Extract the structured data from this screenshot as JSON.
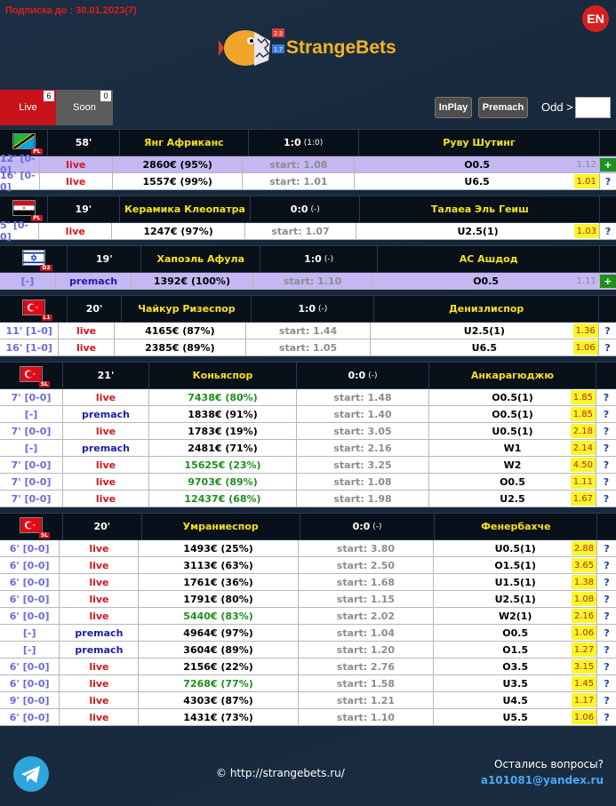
{
  "header": {
    "subscription": "Подписка до : 30.01.2023(7)",
    "lang": "EN",
    "logo_text": "StrangeBets",
    "logo_badge_top": "2.3",
    "logo_badge_bottom": "1.7"
  },
  "tabs": [
    {
      "label": "Live",
      "count": "6"
    },
    {
      "label": "Soon",
      "count": "0"
    }
  ],
  "filters": {
    "inplay": "InPlay",
    "premach": "Premach",
    "odd_label": "Odd >",
    "odd_value": ""
  },
  "matches": [
    {
      "flag": "tanzania",
      "league": "PL",
      "minute": "58'",
      "home": "Янг Африканс",
      "score": "1:0",
      "score_ht": "(1:0)",
      "away": "Руву Шутинг",
      "cols": [
        54,
        100,
        178,
        153,
        167,
        168,
        22
      ],
      "rows": [
        {
          "time": "12' [0-0]",
          "type": "live",
          "money": "2860€ (95%)",
          "start": "start: 1.08",
          "bet": "O0.5",
          "odd": "1.12",
          "act": "+",
          "hl": true
        },
        {
          "time": "16' [0-0]",
          "type": "live",
          "money": "1557€ (99%)",
          "start": "start: 1.01",
          "bet": "U6.5",
          "odd": "1.01",
          "act": "?"
        }
      ]
    },
    {
      "flag": "egypt",
      "league": "PL",
      "minute": "19'",
      "home": "Керамика Клеопатра",
      "score": "0:0",
      "score_ht": "(-)",
      "away": "Талаеа Эль Геиш",
      "cols": [
        54,
        100,
        183,
        153,
        167,
        168,
        22
      ],
      "rows": [
        {
          "time": "5' [0-0]",
          "type": "live",
          "money": "1247€ (97%)",
          "start": "start: 1.07",
          "bet": "U2.5(1)",
          "odd": "1.03",
          "act": "?"
        }
      ]
    },
    {
      "flag": "israel",
      "league": "D2",
      "minute": "19'",
      "home": "Хапоэль Афула",
      "score": "1:0",
      "score_ht": "(-)",
      "away": "АС Ашдод",
      "cols": [
        76,
        103,
        165,
        163,
        161,
        148,
        22
      ],
      "rows": [
        {
          "time": "[-]",
          "type": "premach",
          "money": "1392€ (100%)",
          "start": "start: 1.10",
          "bet": "O0.5",
          "odd": "1.11",
          "act": "+",
          "hl": true
        }
      ]
    },
    {
      "flag": "turkey",
      "league": "L1",
      "minute": "20'",
      "home": "Чайкур Ризеспор",
      "score": "1:0",
      "score_ht": "(-)",
      "away": "Денизлиспор",
      "cols": [
        76,
        71,
        170,
        160,
        168,
        126,
        22
      ],
      "rows": [
        {
          "time": "11' [1-0]",
          "type": "live",
          "money": "4165€ (87%)",
          "start": "start: 1.44",
          "bet": "U2.5(1)",
          "odd": "1.36",
          "act": "?"
        },
        {
          "time": "16' [1-0]",
          "type": "live",
          "money": "2385€ (89%)",
          "start": "start: 1.05",
          "bet": "U6.5",
          "odd": "1.06",
          "act": "?"
        }
      ]
    },
    {
      "flag": "turkey",
      "league": "SL",
      "minute": "21'",
      "home": "Коньяспор",
      "score": "0:0",
      "score_ht": "(-)",
      "away": "Анкарагюджю",
      "cols": [
        71,
        97,
        166,
        149,
        188,
        22
      ],
      "rows": [
        {
          "time": "7' [0-0]",
          "type": "live",
          "money": "7438€ (80%)",
          "start": "start: 1.48",
          "bet": "O0.5(1)",
          "odd": "1.85",
          "act": "?",
          "green": true
        },
        {
          "time": "[-]",
          "type": "premach",
          "money": "1838€ (91%)",
          "start": "start: 1.40",
          "bet": "O0.5(1)",
          "odd": "1.85",
          "act": "?"
        },
        {
          "time": "7' [0-0]",
          "type": "live",
          "money": "1783€ (19%)",
          "start": "start: 3.05",
          "bet": "U0.5(1)",
          "odd": "2.18",
          "act": "?"
        },
        {
          "time": "[-]",
          "type": "premach",
          "money": "2481€ (71%)",
          "start": "start: 2.16",
          "bet": "W1",
          "odd": "2.14",
          "act": "?"
        },
        {
          "time": "7' [0-0]",
          "type": "live",
          "money": "15625€ (23%)",
          "start": "start: 3.25",
          "bet": "W2",
          "odd": "4.50",
          "act": "?",
          "green": true
        },
        {
          "time": "7' [0-0]",
          "type": "live",
          "money": "9703€ (89%)",
          "start": "start: 1.08",
          "bet": "O0.5",
          "odd": "1.11",
          "act": "?",
          "green": true
        },
        {
          "time": "7' [0-0]",
          "type": "live",
          "money": "12437€ (68%)",
          "start": "start: 1.98",
          "bet": "U2.5",
          "odd": "1.67",
          "act": "?",
          "green": true
        }
      ]
    },
    {
      "flag": "turkey",
      "league": "SL",
      "minute": "20'",
      "home": "Умраниеспор",
      "score": "0:0",
      "score_ht": "(-)",
      "away": "Фенербахче",
      "cols": [
        71,
        94,
        189,
        161,
        194,
        22
      ],
      "rows": [
        {
          "time": "6' [0-0]",
          "type": "live",
          "money": "1493€ (25%)",
          "start": "start: 3.80",
          "bet": "U0.5(1)",
          "odd": "2.88",
          "act": "?"
        },
        {
          "time": "6' [0-0]",
          "type": "live",
          "money": "3113€ (63%)",
          "start": "start: 2.50",
          "bet": "O1.5(1)",
          "odd": "3.65",
          "act": "?"
        },
        {
          "time": "6' [0-0]",
          "type": "live",
          "money": "1761€ (36%)",
          "start": "start: 1.68",
          "bet": "U1.5(1)",
          "odd": "1.38",
          "act": "?"
        },
        {
          "time": "6' [0-0]",
          "type": "live",
          "money": "1791€ (80%)",
          "start": "start: 1.15",
          "bet": "U2.5(1)",
          "odd": "1.08",
          "act": "?"
        },
        {
          "time": "6' [0-0]",
          "type": "live",
          "money": "5440€ (83%)",
          "start": "start: 2.02",
          "bet": "W2(1)",
          "odd": "2.16",
          "act": "?",
          "green": true
        },
        {
          "time": "[-]",
          "type": "premach",
          "money": "4964€ (97%)",
          "start": "start: 1.04",
          "bet": "O0.5",
          "odd": "1.06",
          "act": "?"
        },
        {
          "time": "[-]",
          "type": "premach",
          "money": "3604€ (89%)",
          "start": "start: 1.20",
          "bet": "O1.5",
          "odd": "1.27",
          "act": "?"
        },
        {
          "time": "6' [0-0]",
          "type": "live",
          "money": "2156€ (22%)",
          "start": "start: 2.76",
          "bet": "O3.5",
          "odd": "3.15",
          "act": "?"
        },
        {
          "time": "6' [0-0]",
          "type": "live",
          "money": "7268€ (77%)",
          "start": "start: 1.58",
          "bet": "U3.5",
          "odd": "1.45",
          "act": "?",
          "green": true
        },
        {
          "time": "9' [0-0]",
          "type": "live",
          "money": "4303€ (87%)",
          "start": "start: 1.21",
          "bet": "U4.5",
          "odd": "1.17",
          "act": "?"
        },
        {
          "time": "6' [0-0]",
          "type": "live",
          "money": "1431€ (73%)",
          "start": "start: 1.10",
          "bet": "U5.5",
          "odd": "1.06",
          "act": "?"
        }
      ]
    }
  ],
  "footer": {
    "site": "© http://strangebets.ru/",
    "question": "Остались вопросы?",
    "email": "a101081@yandex.ru"
  }
}
